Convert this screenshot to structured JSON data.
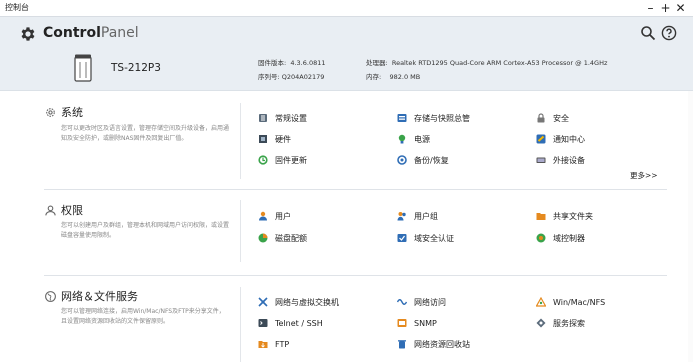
{
  "window": {
    "title": "控制台",
    "min": "–",
    "max": "+",
    "close": "✕"
  },
  "header": {
    "brand_bold": "Control",
    "brand_thin": "Panel",
    "model": "TS-212P3",
    "firmware_label": "固件版本:",
    "firmware_value": "4.3.6.0811",
    "serial_label": "序列号:",
    "serial_value": "Q204A02179",
    "cpu_label": "处理器:",
    "cpu_value": "Realtek RTD1295 Quad-Core ARM Cortex-A53 Processor @ 1.4GHz",
    "mem_label": "内存:",
    "mem_value": "982.0 MB"
  },
  "sections": {
    "system": {
      "title": "系统",
      "desc": "您可以更改时区及语言设置，管理存储空间及升级设备，启用通知及安全防护，或删除NAS固件及回复出厂值。",
      "items": [
        "常规设置",
        "存储与快照总管",
        "安全",
        "硬件",
        "电源",
        "通知中心",
        "固件更新",
        "备份/恢复",
        "外接设备"
      ],
      "more": "更多>>"
    },
    "privilege": {
      "title": "权限",
      "desc": "您可以创建用户及群组，管理本机和网域用户访问权限，或设置磁盘容量使用限制。",
      "items": [
        "用户",
        "用户组",
        "共享文件夹",
        "磁盘配额",
        "域安全认证",
        "域控制器"
      ]
    },
    "network": {
      "title": "网络＆文件服务",
      "desc": "您可以管理网络连接，启用Win/Mac/NFS及FTP来分享文件，且设置网络资源回收站的文件保留原则。",
      "items": [
        "网络与虚拟交换机",
        "网络访问",
        "Win/Mac/NFS",
        "Telnet / SSH",
        "SNMP",
        "服务探索",
        "FTP",
        "网络资源回收站"
      ]
    }
  },
  "icons": {
    "brand": "gear-icon",
    "search": "search-icon",
    "help": "help-icon",
    "nas": "nas-device-icon",
    "system": "system-gear-icon",
    "privilege": "user-icon",
    "network": "globe-icon"
  },
  "colors": {
    "header_bg": "#e9eef3",
    "accent_blue": "#2f6db5",
    "orange": "#e58a1f",
    "green": "#3aa34a"
  }
}
